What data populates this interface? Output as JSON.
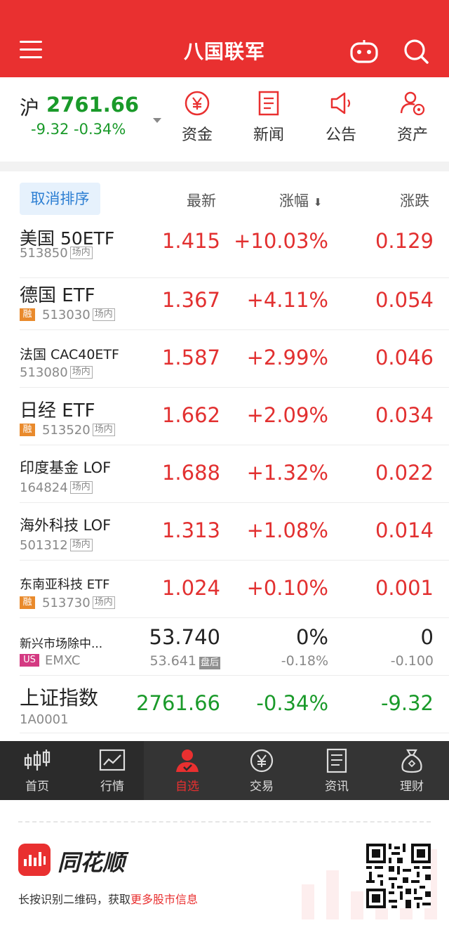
{
  "header": {
    "title": "八国联军",
    "menu_icon": "hamburger-menu-icon",
    "robot_icon": "robot-assistant-icon",
    "search_icon": "search-icon",
    "bg_color": "#e93030"
  },
  "index": {
    "name": "沪",
    "value": "2761.66",
    "change": "-9.32",
    "change_pct": "-0.34%"
  },
  "quick_actions": [
    {
      "label": "资金",
      "icon": "yuan-circle-icon"
    },
    {
      "label": "新闻",
      "icon": "document-icon"
    },
    {
      "label": "公告",
      "icon": "megaphone-icon"
    },
    {
      "label": "资产",
      "icon": "asset-user-icon"
    }
  ],
  "columns": {
    "sort_button": "取消排序",
    "latest": "最新",
    "change_pct": "涨幅",
    "change": "涨跌"
  },
  "rows": [
    {
      "name": "美国 50ETF",
      "code": "513850",
      "market": "场内",
      "price": "1.415",
      "pct": "+10.03%",
      "chg": "0.129"
    },
    {
      "name": "德国 ETF",
      "rong": "融",
      "code": "513030",
      "market": "场内",
      "price": "1.367",
      "pct": "+4.11%",
      "chg": "0.054"
    },
    {
      "name": "法国 CAC40ETF",
      "code": "513080",
      "market": "场内",
      "price": "1.587",
      "pct": "+2.99%",
      "chg": "0.046"
    },
    {
      "name": "日经 ETF",
      "rong": "融",
      "code": "513520",
      "market": "场内",
      "price": "1.662",
      "pct": "+2.09%",
      "chg": "0.034"
    },
    {
      "name": "印度基金 LOF",
      "code": "164824",
      "market": "场内",
      "price": "1.688",
      "pct": "+1.32%",
      "chg": "0.022"
    },
    {
      "name": "海外科技 LOF",
      "code": "501312",
      "market": "场内",
      "price": "1.313",
      "pct": "+1.08%",
      "chg": "0.014"
    },
    {
      "name": "东南亚科技 ETF",
      "rong": "融",
      "code": "513730",
      "market": "场内",
      "price": "1.024",
      "pct": "+0.10%",
      "chg": "0.001"
    },
    {
      "name": "新兴市场除中...",
      "us": "US",
      "code": "EMXC",
      "price": "53.740",
      "sub_price": "53.641",
      "after": "盘后",
      "pct": "0%",
      "sub_pct": "-0.18%",
      "chg": "0",
      "sub_chg": "-0.100"
    },
    {
      "name": "上证指数",
      "code": "1A0001",
      "price": "2761.66",
      "pct": "-0.34%",
      "chg": "-9.32"
    }
  ],
  "nav": [
    {
      "label": "首页",
      "icon": "candlestick-icon"
    },
    {
      "label": "行情",
      "icon": "line-chart-icon"
    },
    {
      "label": "自选",
      "icon": "user-favorite-icon"
    },
    {
      "label": "交易",
      "icon": "yuan-circle-icon"
    },
    {
      "label": "资讯",
      "icon": "news-icon"
    },
    {
      "label": "理财",
      "icon": "money-bag-icon"
    }
  ],
  "footer": {
    "brand": "同花顺",
    "note_prefix": "长按识别二维码，获取",
    "note_highlight": "更多股市信息"
  }
}
